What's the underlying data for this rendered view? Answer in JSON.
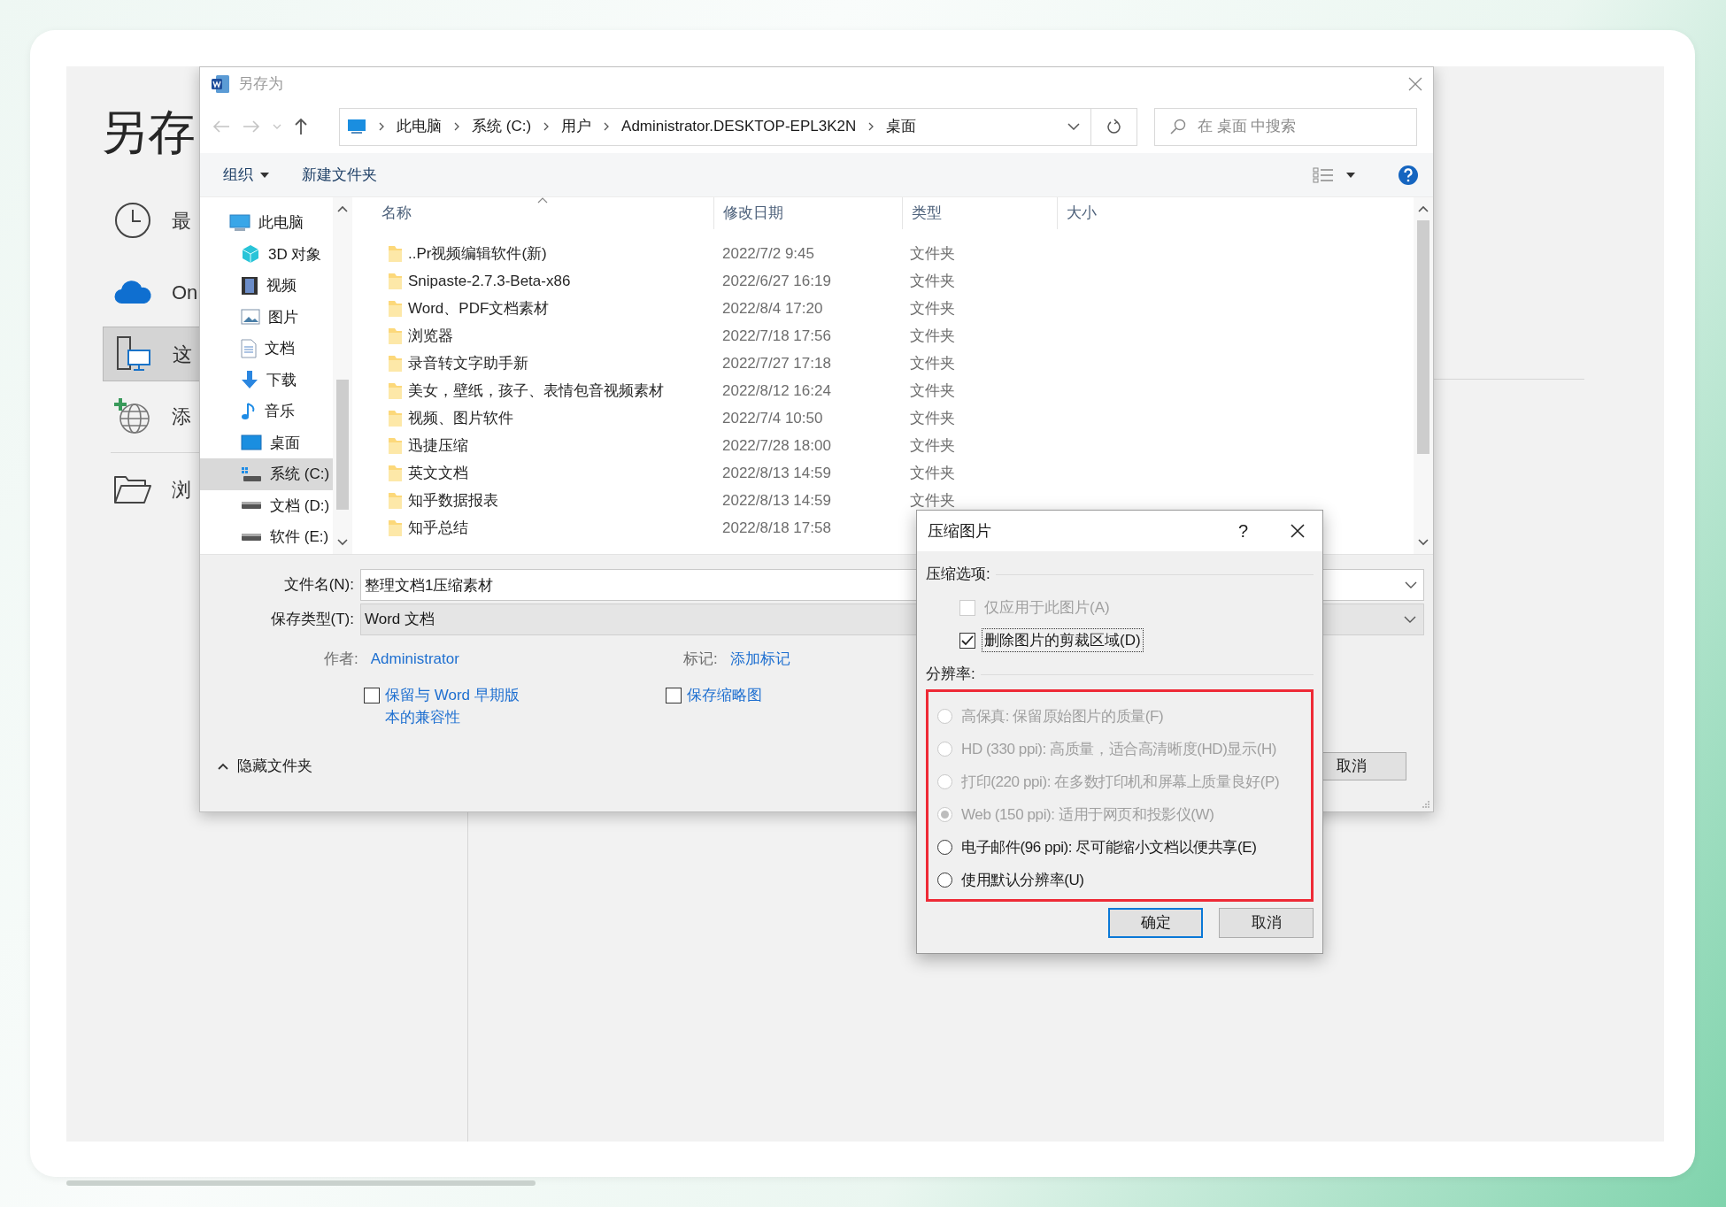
{
  "backstage": {
    "title": "另存",
    "nav": [
      {
        "kind": "recent",
        "label": "最",
        "selected": false
      },
      {
        "kind": "cloud",
        "label": "On",
        "selected": false
      },
      {
        "kind": "pc",
        "label": "这",
        "selected": true
      },
      {
        "kind": "add",
        "label": "添",
        "selected": false
      },
      {
        "kind": "browse",
        "label": "浏",
        "selected": false
      }
    ]
  },
  "save_dialog": {
    "title": "另存为",
    "breadcrumb": [
      "此电脑",
      "系统 (C:)",
      "用户",
      "Administrator.DESKTOP-EPL3K2N",
      "桌面"
    ],
    "search": {
      "placeholder": "在 桌面 中搜索"
    },
    "toolbar": {
      "organize": "组织",
      "new_folder": "新建文件夹"
    },
    "nav_tree": [
      {
        "label": "此电脑",
        "kind": "pc",
        "selected": false,
        "children": [
          {
            "label": "3D 对象",
            "kind": "cube",
            "selected": false
          },
          {
            "label": "视频",
            "kind": "video",
            "selected": false
          },
          {
            "label": "图片",
            "kind": "image",
            "selected": false
          },
          {
            "label": "文档",
            "kind": "doc",
            "selected": false
          },
          {
            "label": "下载",
            "kind": "download",
            "selected": false
          },
          {
            "label": "音乐",
            "kind": "music",
            "selected": false
          },
          {
            "label": "桌面",
            "kind": "desktop",
            "selected": false
          },
          {
            "label": "系统 (C:)",
            "kind": "system",
            "selected": true
          },
          {
            "label": "文档 (D:)",
            "kind": "drive",
            "selected": false
          },
          {
            "label": "软件 (E:)",
            "kind": "drive",
            "selected": false
          }
        ]
      }
    ],
    "columns": [
      "名称",
      "修改日期",
      "类型",
      "大小"
    ],
    "rows": [
      {
        "name": "..Pr视频编辑软件(新)",
        "modified": "2022/7/2 9:45",
        "type": "文件夹"
      },
      {
        "name": "Snipaste-2.7.3-Beta-x86",
        "modified": "2022/6/27 16:19",
        "type": "文件夹"
      },
      {
        "name": "Word、PDF文档素材",
        "modified": "2022/8/4 17:20",
        "type": "文件夹"
      },
      {
        "name": "浏览器",
        "modified": "2022/7/18 17:56",
        "type": "文件夹"
      },
      {
        "name": "录音转文字助手新",
        "modified": "2022/7/27 17:18",
        "type": "文件夹"
      },
      {
        "name": "美女，壁纸，孩子、表情包音视频素材",
        "modified": "2022/8/12 16:24",
        "type": "文件夹"
      },
      {
        "name": "视频、图片软件",
        "modified": "2022/7/4 10:50",
        "type": "文件夹"
      },
      {
        "name": "迅捷压缩",
        "modified": "2022/7/28 18:00",
        "type": "文件夹"
      },
      {
        "name": "英文文档",
        "modified": "2022/8/13 14:59",
        "type": "文件夹"
      },
      {
        "name": "知乎数据报表",
        "modified": "2022/8/13 14:59",
        "type": "文件夹"
      },
      {
        "name": "知乎总结",
        "modified": "2022/8/18 17:58"
      }
    ],
    "file_name": {
      "label": "文件名(N):",
      "value": "整理文档1压缩素材"
    },
    "save_type": {
      "label": "保存类型(T):",
      "value": "Word 文档"
    },
    "author": {
      "label": "作者:",
      "value": "Administrator"
    },
    "tags": {
      "label": "标记:",
      "value": "添加标记"
    },
    "options": [
      {
        "lines": [
          "保留与 Word 早期版",
          "本的兼容性"
        ],
        "checked": false
      },
      {
        "lines": [
          "保存缩略图"
        ],
        "checked": false
      }
    ],
    "hide_folders": "隐藏文件夹",
    "cancel": "取消"
  },
  "compress_dialog": {
    "title": "压缩图片",
    "help": "?",
    "options_label": "压缩选项:",
    "options": [
      {
        "label": "仅应用于此图片(A)",
        "checked": false,
        "disabled": true
      },
      {
        "label": "删除图片的剪裁区域(D)",
        "checked": true,
        "disabled": false
      }
    ],
    "resolution_label": "分辨率:",
    "resolutions": [
      {
        "label": "高保真: 保留原始图片的质量(F)",
        "selected": false,
        "disabled": true
      },
      {
        "label": "HD (330 ppi): 高质量，适合高清晰度(HD)显示(H)",
        "selected": false,
        "disabled": true
      },
      {
        "label": "打印(220 ppi): 在多数打印机和屏幕上质量良好(P)",
        "selected": false,
        "disabled": true
      },
      {
        "label": "Web (150 ppi): 适用于网页和投影仪(W)",
        "selected": true,
        "disabled": true
      },
      {
        "label": "电子邮件(96 ppi): 尽可能缩小文档以便共享(E)",
        "selected": false,
        "disabled": false
      },
      {
        "label": "使用默认分辨率(U)",
        "selected": false,
        "disabled": false
      }
    ],
    "buttons": [
      {
        "label": "确定",
        "default": true
      },
      {
        "label": "取消",
        "default": false
      }
    ]
  }
}
